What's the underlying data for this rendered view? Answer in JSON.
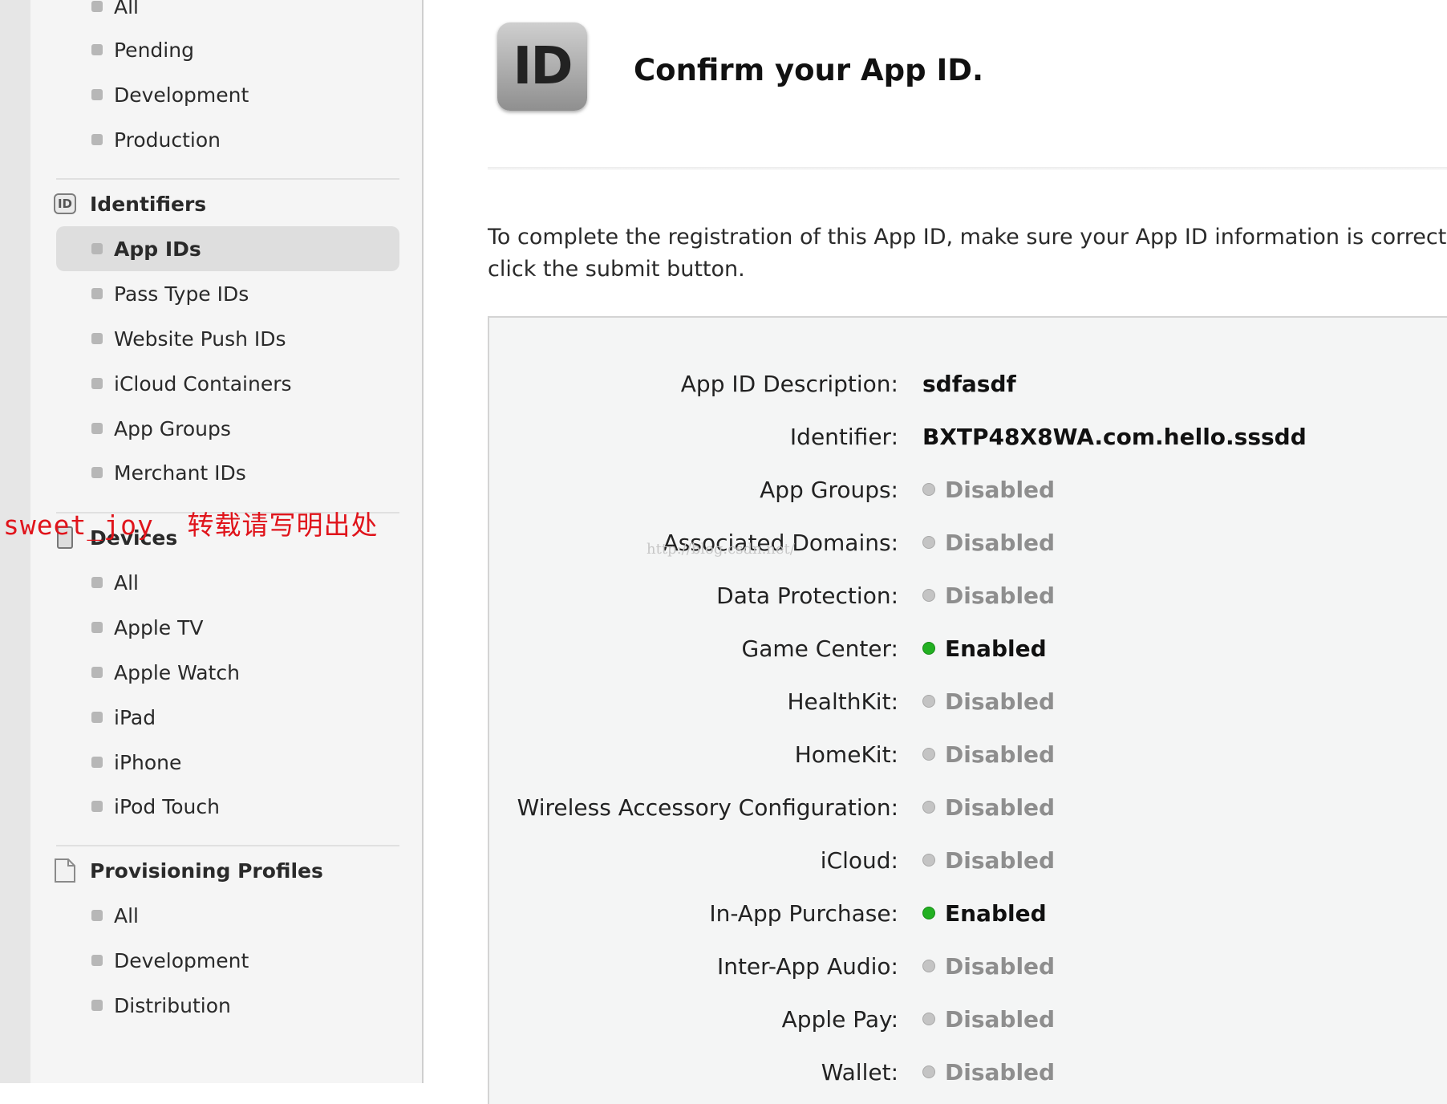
{
  "sidebar": {
    "certificates_items": [
      {
        "label": "All"
      },
      {
        "label": "Pending"
      },
      {
        "label": "Development"
      },
      {
        "label": "Production"
      }
    ],
    "identifiers": {
      "title": "Identifiers",
      "icon_text": "ID",
      "items": [
        {
          "label": "App IDs",
          "active": true
        },
        {
          "label": "Pass Type IDs"
        },
        {
          "label": "Website Push IDs"
        },
        {
          "label": "iCloud Containers"
        },
        {
          "label": "App Groups"
        },
        {
          "label": "Merchant IDs"
        }
      ]
    },
    "devices": {
      "title": "Devices",
      "items": [
        {
          "label": "All"
        },
        {
          "label": "Apple TV"
        },
        {
          "label": "Apple Watch"
        },
        {
          "label": "iPad"
        },
        {
          "label": "iPhone"
        },
        {
          "label": "iPod Touch"
        }
      ]
    },
    "provisioning": {
      "title": "Provisioning Profiles",
      "items": [
        {
          "label": "All"
        },
        {
          "label": "Development"
        },
        {
          "label": "Distribution"
        }
      ]
    }
  },
  "watermark": {
    "overlay_text": "sweet_joy  转载请写明出处",
    "url_text": "http://blog.csdn.net/"
  },
  "main": {
    "icon_text": "ID",
    "title": "Confirm your App ID.",
    "intro_text": "To complete the registration of this App ID, make sure your App ID information is correct, click the submit button.",
    "details": [
      {
        "label": "App ID Description:",
        "value": "sdfasdf",
        "status": null
      },
      {
        "label": "Identifier:",
        "value": "BXTP48X8WA.com.hello.sssdd",
        "status": null
      },
      {
        "label": "App Groups:",
        "value": "Disabled",
        "status": "disabled"
      },
      {
        "label": "Associated Domains:",
        "value": "Disabled",
        "status": "disabled"
      },
      {
        "label": "Data Protection:",
        "value": "Disabled",
        "status": "disabled"
      },
      {
        "label": "Game Center:",
        "value": "Enabled",
        "status": "enabled"
      },
      {
        "label": "HealthKit:",
        "value": "Disabled",
        "status": "disabled"
      },
      {
        "label": "HomeKit:",
        "value": "Disabled",
        "status": "disabled"
      },
      {
        "label": "Wireless Accessory Configuration:",
        "value": "Disabled",
        "status": "disabled"
      },
      {
        "label": "iCloud:",
        "value": "Disabled",
        "status": "disabled"
      },
      {
        "label": "In-App Purchase:",
        "value": "Enabled",
        "status": "enabled"
      },
      {
        "label": "Inter-App Audio:",
        "value": "Disabled",
        "status": "disabled"
      },
      {
        "label": "Apple Pay:",
        "value": "Disabled",
        "status": "disabled"
      },
      {
        "label": "Wallet:",
        "value": "Disabled",
        "status": "disabled"
      }
    ]
  },
  "colors": {
    "enabled": "#22b022",
    "disabled": "#c4c4c4",
    "watermark": "#e0141b"
  }
}
